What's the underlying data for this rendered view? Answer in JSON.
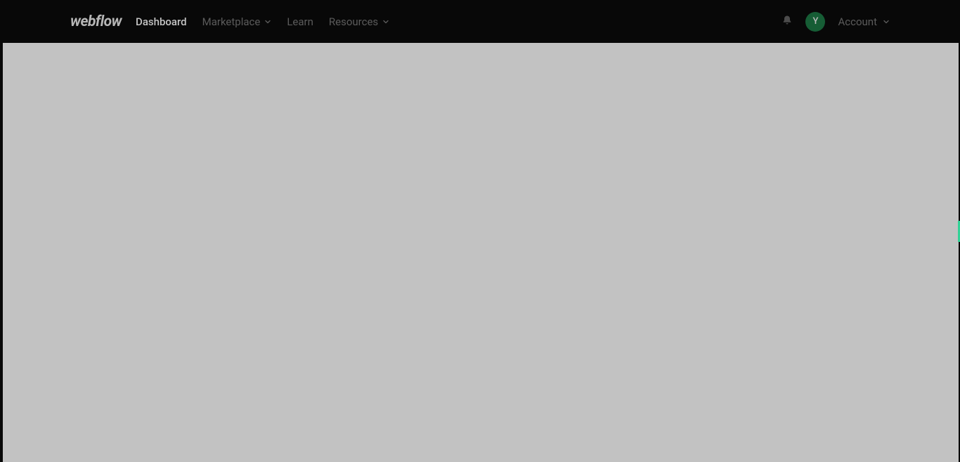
{
  "brand": "webflow",
  "nav": {
    "dashboard": "Dashboard",
    "marketplace": "Marketplace",
    "learn": "Learn",
    "resources": "Resources"
  },
  "account": {
    "label": "Account",
    "initial": "Y"
  }
}
